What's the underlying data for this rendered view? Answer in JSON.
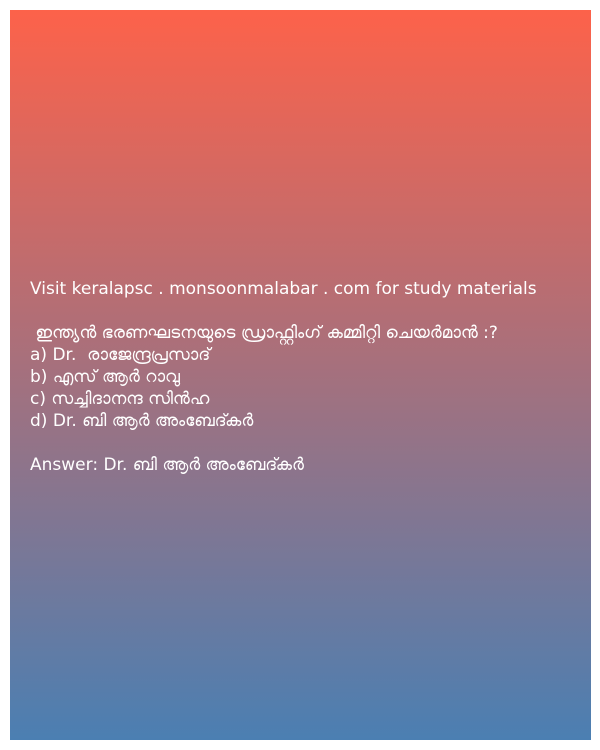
{
  "card": {
    "gradient_top": "#fd624a",
    "gradient_bottom": "#4b7fb2",
    "visit_text": "Visit keralapsc . monsoonmalabar . com for study materials",
    "question": " ഇന്ത്യൻ ഭരണഘടനയുടെ ഡ്രാഫ്റ്റിംഗ് കമ്മിറ്റി ചെയർമാൻ :?",
    "options": [
      "a) Dr.  രാജേന്ദ്രപ്രസാദ്",
      "b) എസ് ആർ റാവു",
      "c) സച്ചിദാനന്ദ സിൻഹ",
      "d) Dr. ബി ആർ അംബേദ്കർ"
    ],
    "answer": "Answer: Dr. ബി ആർ അംബേദ്കർ"
  }
}
